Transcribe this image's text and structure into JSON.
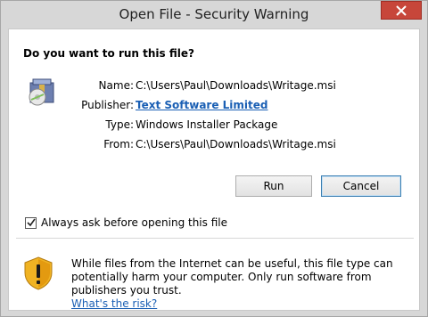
{
  "window": {
    "title": "Open File - Security Warning",
    "close_icon": "close-icon"
  },
  "dialog": {
    "question": "Do you want to run this file?",
    "file_icon": "installer-package-icon",
    "fields": [
      {
        "label": "Name:",
        "value": "C:\\Users\\Paul\\Downloads\\Writage.msi"
      },
      {
        "label": "Publisher:",
        "value": "Text Software Limited"
      },
      {
        "label": "Type:",
        "value": "Windows Installer Package"
      },
      {
        "label": "From:",
        "value": "C:\\Users\\Paul\\Downloads\\Writage.msi"
      }
    ],
    "buttons": {
      "run": "Run",
      "cancel": "Cancel"
    },
    "checkbox": {
      "label": "Always ask before opening this file",
      "checked": true
    },
    "warning": {
      "icon": "security-shield-icon",
      "text": "While files from the Internet can be useful, this file type can potentially harm your computer. Only run software from publishers you trust.",
      "link": "What's the risk?"
    }
  },
  "colors": {
    "close_button": "#c7463a",
    "link": "#1a5fb4",
    "frame": "#d7d7d7"
  }
}
